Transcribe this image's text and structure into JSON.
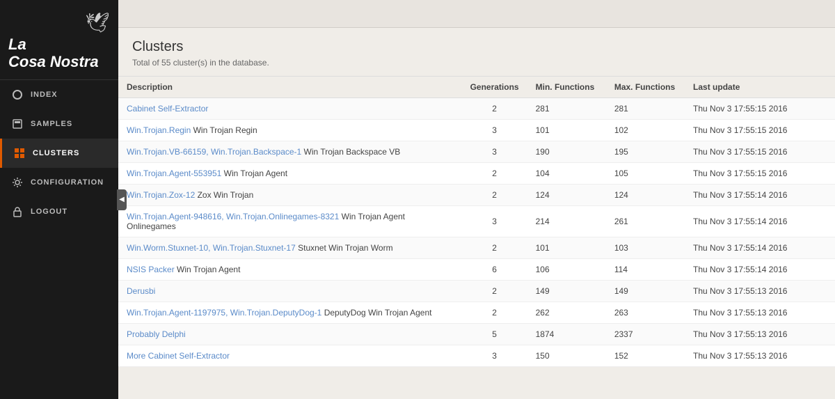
{
  "sidebar": {
    "logo_line1": "La",
    "logo_line2": "Cosa Nostra",
    "nav_items": [
      {
        "id": "index",
        "label": "INDEX",
        "icon": "circle",
        "active": false
      },
      {
        "id": "samples",
        "label": "SAMPLES",
        "icon": "disk",
        "active": false
      },
      {
        "id": "clusters",
        "label": "CLUSTERS",
        "icon": "grid",
        "active": true
      },
      {
        "id": "configuration",
        "label": "CONFIGURATION",
        "icon": "gear",
        "active": false
      },
      {
        "id": "logout",
        "label": "LOGOUT",
        "icon": "lock",
        "active": false
      }
    ],
    "collapse_icon": "◀"
  },
  "topbar": {},
  "page": {
    "title": "Clusters",
    "subtitle": "Total of 55 cluster(s) in the database."
  },
  "table": {
    "columns": [
      {
        "id": "description",
        "label": "Description"
      },
      {
        "id": "generations",
        "label": "Generations"
      },
      {
        "id": "min_functions",
        "label": "Min. Functions"
      },
      {
        "id": "max_functions",
        "label": "Max. Functions"
      },
      {
        "id": "last_update",
        "label": "Last update"
      }
    ],
    "rows": [
      {
        "description_link": "Cabinet Self-Extractor",
        "description_text": "",
        "generations": "2",
        "min_functions": "281",
        "max_functions": "281",
        "last_update": "Thu Nov 3 17:55:15 2016"
      },
      {
        "description_link": "Win.Trojan.Regin",
        "description_text": "  Win Trojan Regin",
        "generations": "3",
        "min_functions": "101",
        "max_functions": "102",
        "last_update": "Thu Nov 3 17:55:15 2016"
      },
      {
        "description_link": "Win.Trojan.VB-66159, Win.Trojan.Backspace-1",
        "description_text": "  Win Trojan Backspace VB",
        "generations": "3",
        "min_functions": "190",
        "max_functions": "195",
        "last_update": "Thu Nov 3 17:55:15 2016"
      },
      {
        "description_link": "Win.Trojan.Agent-553951",
        "description_text": "  Win Trojan Agent",
        "generations": "2",
        "min_functions": "104",
        "max_functions": "105",
        "last_update": "Thu Nov 3 17:55:15 2016"
      },
      {
        "description_link": "Win.Trojan.Zox-12",
        "description_text": "  Zox Win Trojan",
        "generations": "2",
        "min_functions": "124",
        "max_functions": "124",
        "last_update": "Thu Nov 3 17:55:14 2016"
      },
      {
        "description_link": "Win.Trojan.Agent-948616, Win.Trojan.Onlinegames-8321",
        "description_text": "  Win Trojan Agent Onlinegames",
        "generations": "3",
        "min_functions": "214",
        "max_functions": "261",
        "last_update": "Thu Nov 3 17:55:14 2016"
      },
      {
        "description_link": "Win.Worm.Stuxnet-10, Win.Trojan.Stuxnet-17",
        "description_text": "  Stuxnet Win Trojan Worm",
        "generations": "2",
        "min_functions": "101",
        "max_functions": "103",
        "last_update": "Thu Nov 3 17:55:14 2016"
      },
      {
        "description_link": "NSIS Packer",
        "description_text": "  Win Trojan Agent",
        "generations": "6",
        "min_functions": "106",
        "max_functions": "114",
        "last_update": "Thu Nov 3 17:55:14 2016"
      },
      {
        "description_link": "Derusbi",
        "description_text": "",
        "generations": "2",
        "min_functions": "149",
        "max_functions": "149",
        "last_update": "Thu Nov 3 17:55:13 2016"
      },
      {
        "description_link": "Win.Trojan.Agent-1197975, Win.Trojan.DeputyDog-1",
        "description_text": "  DeputyDog Win Trojan Agent",
        "generations": "2",
        "min_functions": "262",
        "max_functions": "263",
        "last_update": "Thu Nov 3 17:55:13 2016"
      },
      {
        "description_link": "Probably Delphi",
        "description_text": "",
        "generations": "5",
        "min_functions": "1874",
        "max_functions": "2337",
        "last_update": "Thu Nov 3 17:55:13 2016"
      },
      {
        "description_link": "More Cabinet Self-Extractor",
        "description_text": "",
        "generations": "3",
        "min_functions": "150",
        "max_functions": "152",
        "last_update": "Thu Nov 3 17:55:13 2016"
      }
    ]
  }
}
